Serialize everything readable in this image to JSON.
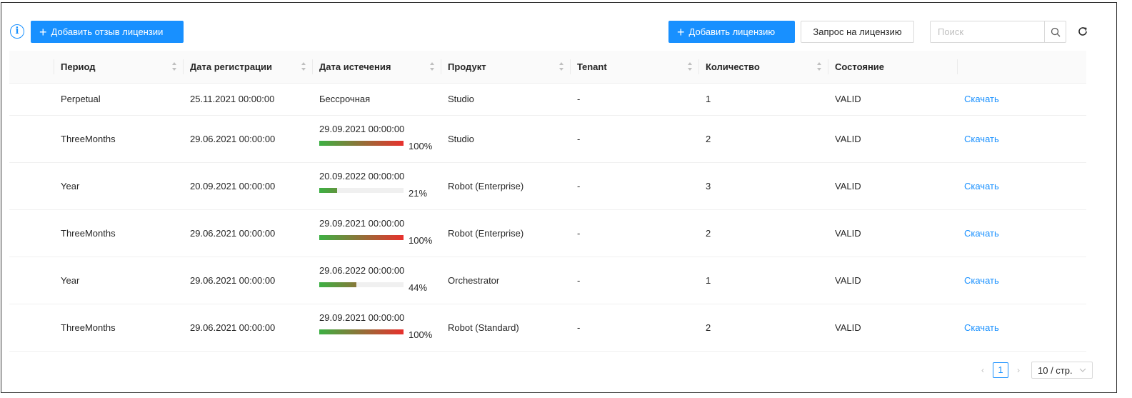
{
  "toolbar": {
    "add_review_label": "Добавить отзыв лицензии",
    "add_license_label": "Добавить лицензию",
    "request_label": "Запрос на лицензию",
    "search_placeholder": "Поиск",
    "search_value": ""
  },
  "colors": {
    "accent": "#1890ff",
    "progress_start": "#3cb043",
    "progress_end": "#e8302d"
  },
  "table": {
    "columns": [
      "Период",
      "Дата регистрации",
      "Дата истечения",
      "Продукт",
      "Tenant",
      "Количество",
      "Состояние"
    ],
    "rows": [
      {
        "period": "Perpetual",
        "registered": "25.11.2021 00:00:00",
        "expiry": "Бессрочная",
        "progress": null,
        "progress_label": "",
        "product": "Studio",
        "tenant": "-",
        "quantity": "1",
        "state": "VALID",
        "action": "Скачать"
      },
      {
        "period": "ThreeMonths",
        "registered": "29.06.2021 00:00:00",
        "expiry": "29.09.2021 00:00:00",
        "progress": 100,
        "progress_label": "100%",
        "product": "Studio",
        "tenant": "-",
        "quantity": "2",
        "state": "VALID",
        "action": "Скачать"
      },
      {
        "period": "Year",
        "registered": "20.09.2021 00:00:00",
        "expiry": "20.09.2022 00:00:00",
        "progress": 21,
        "progress_label": "21%",
        "product": "Robot (Enterprise)",
        "tenant": "-",
        "quantity": "3",
        "state": "VALID",
        "action": "Скачать"
      },
      {
        "period": "ThreeMonths",
        "registered": "29.06.2021 00:00:00",
        "expiry": "29.09.2021 00:00:00",
        "progress": 100,
        "progress_label": "100%",
        "product": "Robot (Enterprise)",
        "tenant": "-",
        "quantity": "2",
        "state": "VALID",
        "action": "Скачать"
      },
      {
        "period": "Year",
        "registered": "29.06.2021 00:00:00",
        "expiry": "29.06.2022 00:00:00",
        "progress": 44,
        "progress_label": "44%",
        "product": "Orchestrator",
        "tenant": "-",
        "quantity": "1",
        "state": "VALID",
        "action": "Скачать"
      },
      {
        "period": "ThreeMonths",
        "registered": "29.06.2021 00:00:00",
        "expiry": "29.09.2021 00:00:00",
        "progress": 100,
        "progress_label": "100%",
        "product": "Robot (Standard)",
        "tenant": "-",
        "quantity": "2",
        "state": "VALID",
        "action": "Скачать"
      }
    ]
  },
  "pagination": {
    "current_page": "1",
    "page_size_label": "10 / стр."
  }
}
